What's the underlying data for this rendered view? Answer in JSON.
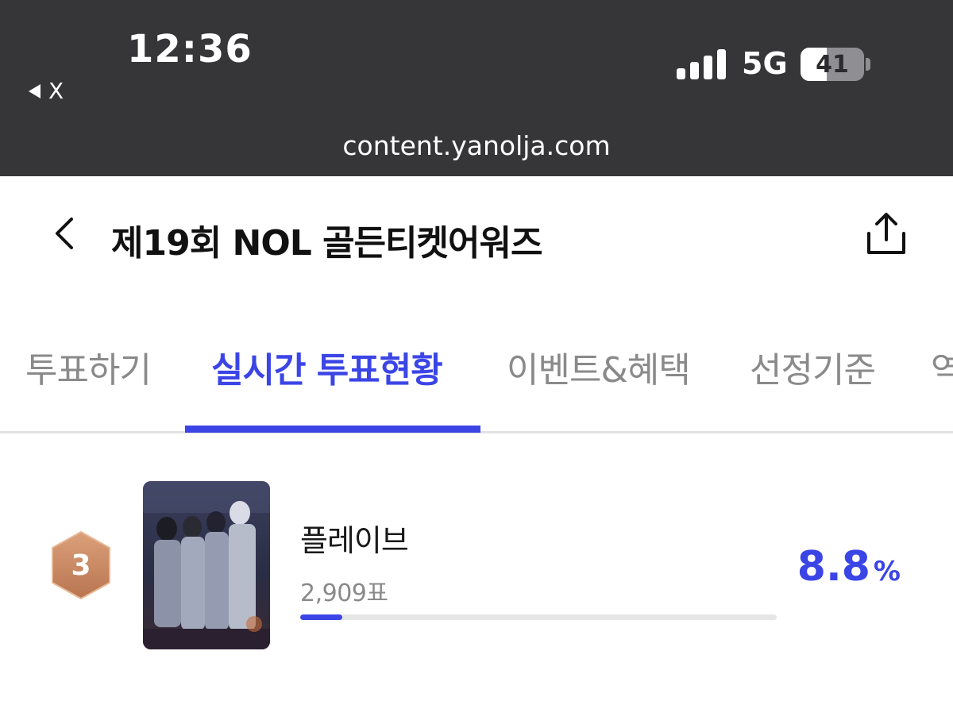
{
  "status_bar": {
    "time": "12:36",
    "back_app_label": "X",
    "network": "5G",
    "battery": 41,
    "url": "content.yanolja.com"
  },
  "header": {
    "title": "제19회 NOL 골든티켓어워즈"
  },
  "tabs": [
    {
      "label": "투표하기",
      "active": false
    },
    {
      "label": "실시간 투표현황",
      "active": true
    },
    {
      "label": "이벤트&혜택",
      "active": false
    },
    {
      "label": "선정기준",
      "active": false
    },
    {
      "label": "역",
      "active": false
    }
  ],
  "ranking": {
    "rank": "3",
    "name": "플레이브",
    "votes": "2,909표",
    "percent_value": "8.8",
    "percent_unit": "%",
    "progress": 0.088
  },
  "colors": {
    "accent": "#3b45e6",
    "status_bar_bg": "#363638",
    "bronze_badge": "#c98a61"
  },
  "icons": {
    "back": "chevron-left-icon",
    "share": "share-icon",
    "signal": "signal-bars-icon",
    "battery": "battery-icon"
  }
}
